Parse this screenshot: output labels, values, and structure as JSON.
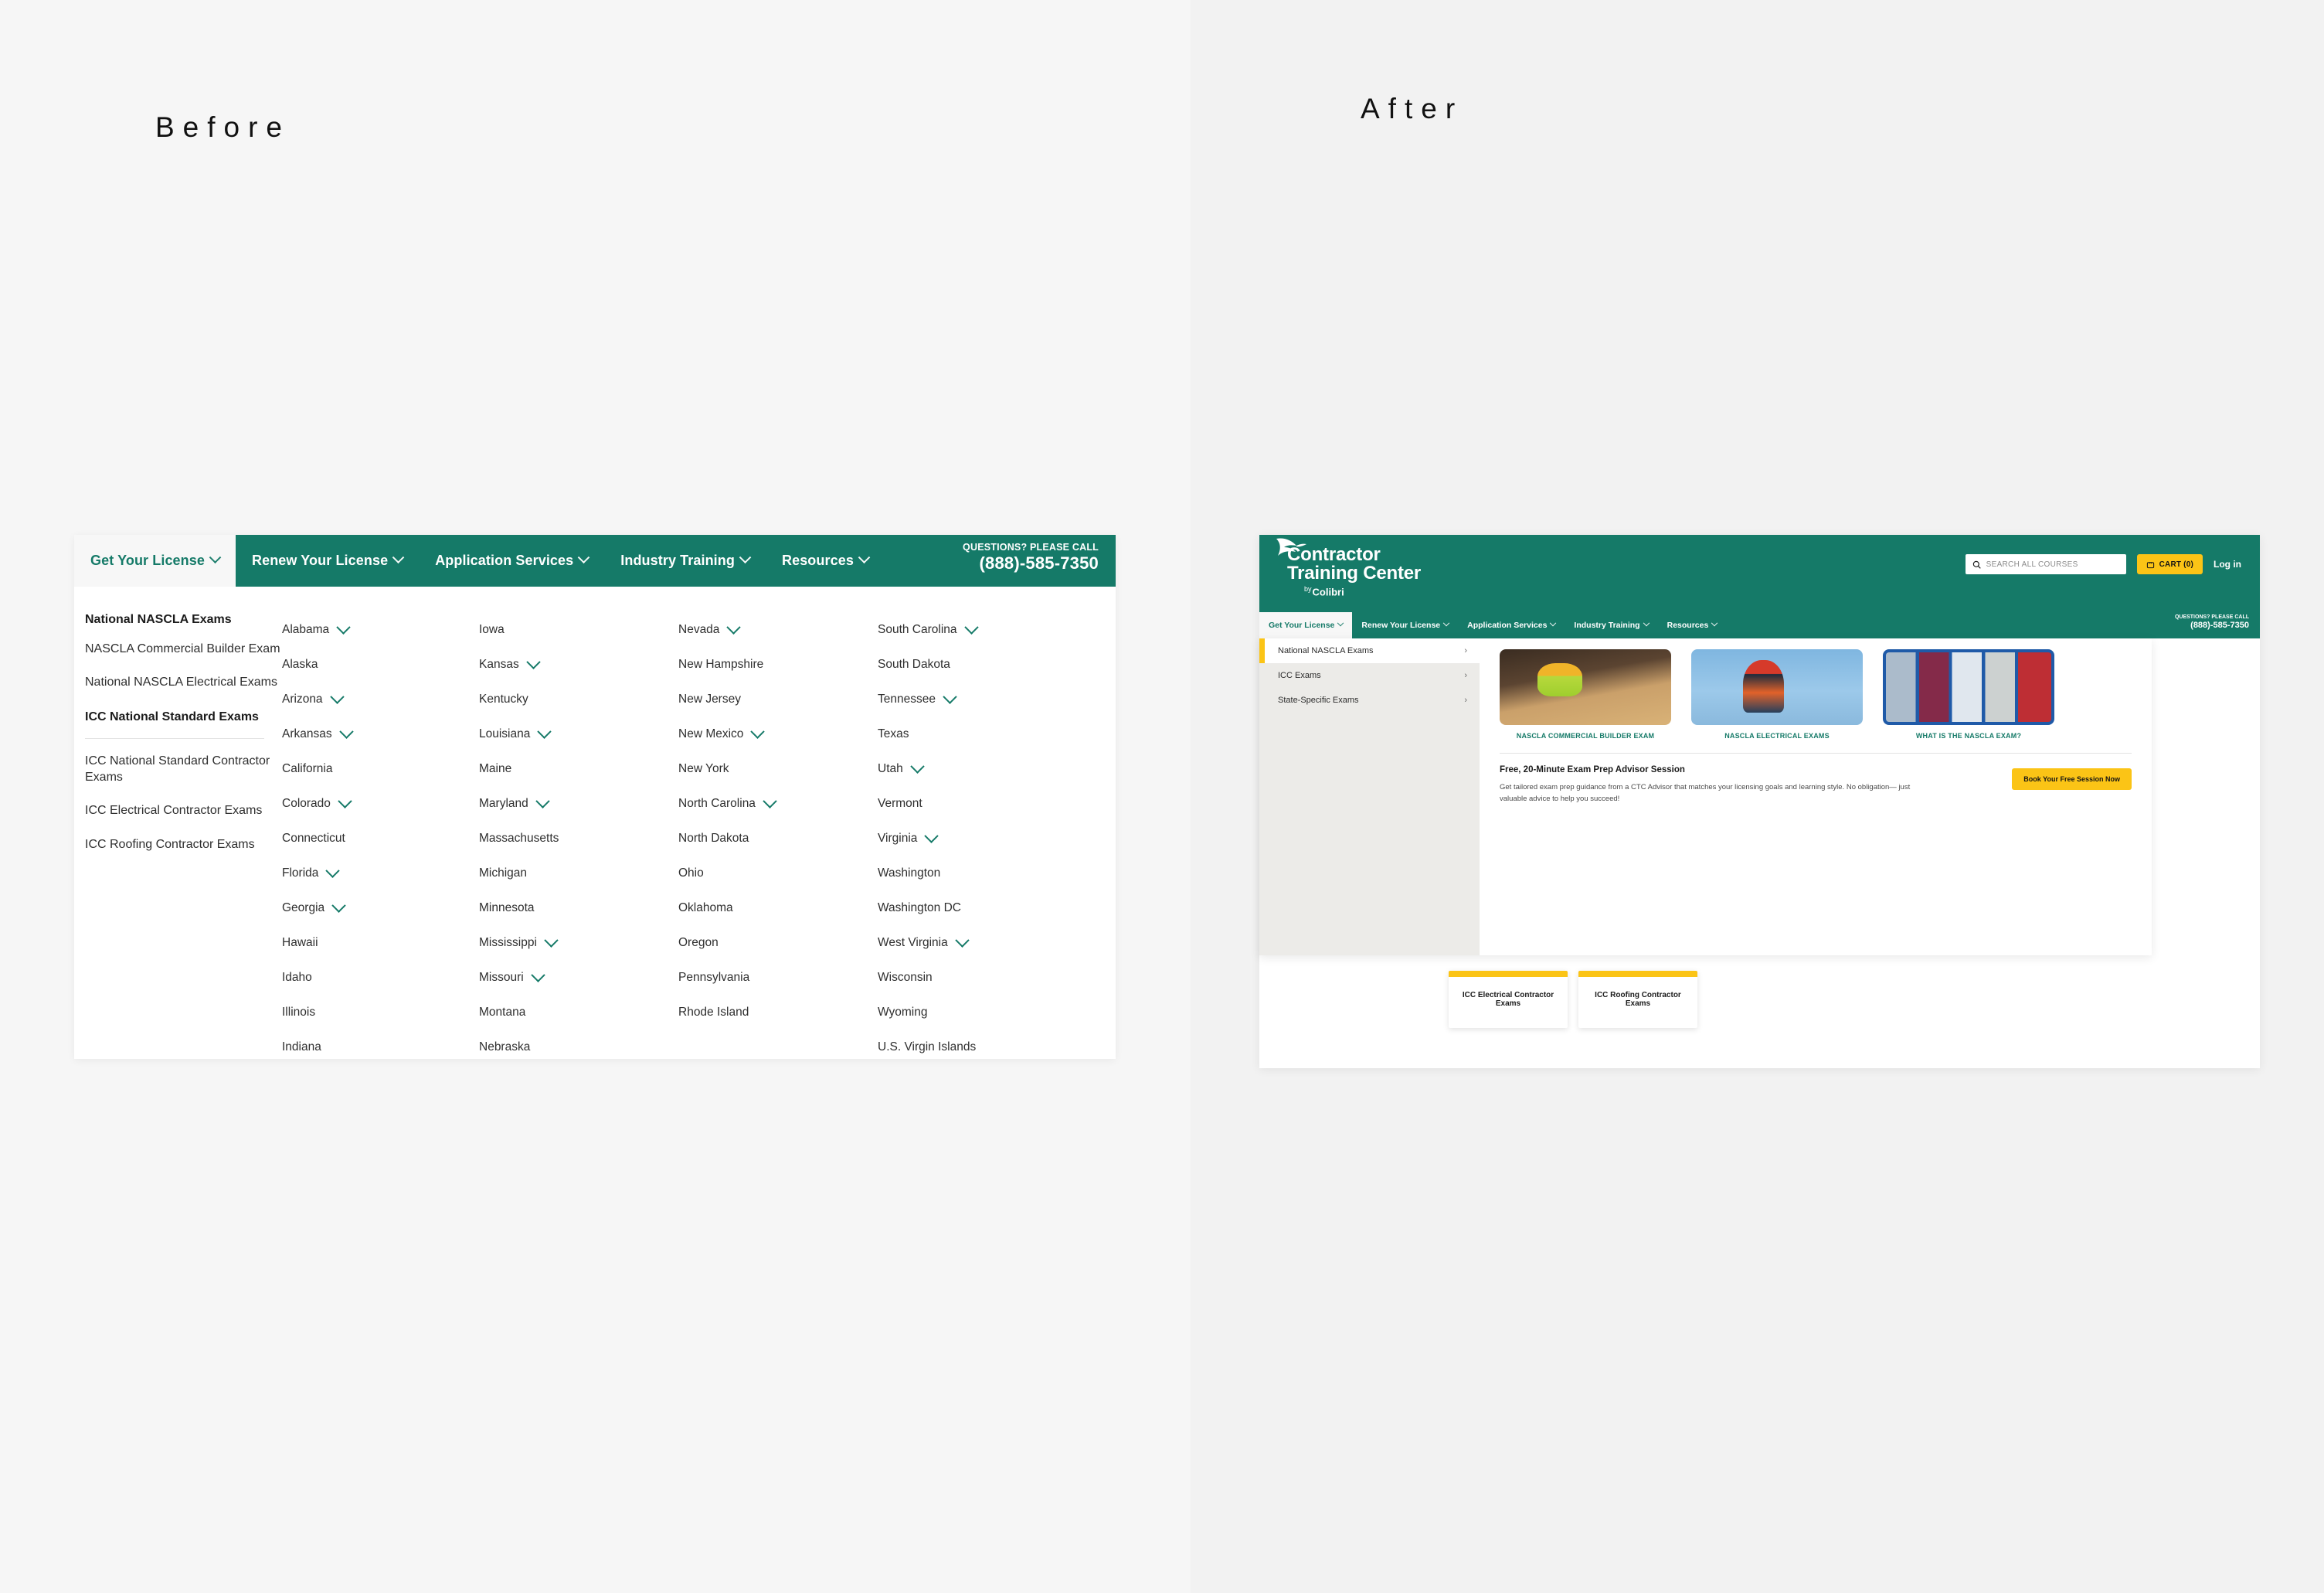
{
  "headings": {
    "before": "Before",
    "after": "After"
  },
  "brand": {
    "name_line1": "Contractor",
    "name_line2": "Training Center",
    "by_prefix": "by",
    "by_name": "Colibri",
    "green": "#157a68",
    "yellow": "#fbc416"
  },
  "before": {
    "nav": {
      "items": [
        {
          "label": "Get Your License",
          "active": true,
          "caret": "chevron-down-icon"
        },
        {
          "label": "Renew Your License",
          "active": false,
          "caret": "chevron-down-icon"
        },
        {
          "label": "Application Services",
          "active": false,
          "caret": "chevron-down-icon"
        },
        {
          "label": "Industry Training",
          "active": false,
          "caret": "chevron-down-icon"
        },
        {
          "label": "Resources",
          "active": false,
          "caret": "chevron-down-icon"
        }
      ],
      "questions_label": "QUESTIONS? PLEASE CALL",
      "phone": "(888)-585-7350"
    },
    "exam_groups": [
      {
        "type": "heading",
        "label": "National NASCLA Exams"
      },
      {
        "type": "link",
        "label": "NASCLA Commercial Builder Exam"
      },
      {
        "type": "link",
        "label": "National NASCLA Electrical Exams"
      },
      {
        "type": "heading",
        "label": "ICC National Standard Exams"
      },
      {
        "type": "link",
        "label": "ICC National Standard Contractor Exams"
      },
      {
        "type": "link",
        "label": "ICC Electrical Contractor Exams"
      },
      {
        "type": "link",
        "label": "ICC Roofing Contractor Exams"
      }
    ],
    "state_columns": [
      [
        {
          "name": "Alabama",
          "caret": true
        },
        {
          "name": "Alaska",
          "caret": false
        },
        {
          "name": "Arizona",
          "caret": true
        },
        {
          "name": "Arkansas",
          "caret": true
        },
        {
          "name": "California",
          "caret": false
        },
        {
          "name": "Colorado",
          "caret": true
        },
        {
          "name": "Connecticut",
          "caret": false
        },
        {
          "name": "Florida",
          "caret": true
        },
        {
          "name": "Georgia",
          "caret": true
        },
        {
          "name": "Hawaii",
          "caret": false
        },
        {
          "name": "Idaho",
          "caret": false
        },
        {
          "name": "Illinois",
          "caret": false
        },
        {
          "name": "Indiana",
          "caret": false
        }
      ],
      [
        {
          "name": "Iowa",
          "caret": false
        },
        {
          "name": "Kansas",
          "caret": true
        },
        {
          "name": "Kentucky",
          "caret": false
        },
        {
          "name": "Louisiana",
          "caret": true
        },
        {
          "name": "Maine",
          "caret": false
        },
        {
          "name": "Maryland",
          "caret": true
        },
        {
          "name": "Massachusetts",
          "caret": false
        },
        {
          "name": "Michigan",
          "caret": false
        },
        {
          "name": "Minnesota",
          "caret": false
        },
        {
          "name": "Mississippi",
          "caret": true
        },
        {
          "name": "Missouri",
          "caret": true
        },
        {
          "name": "Montana",
          "caret": false
        },
        {
          "name": "Nebraska",
          "caret": false
        }
      ],
      [
        {
          "name": "Nevada",
          "caret": true
        },
        {
          "name": "New Hampshire",
          "caret": false
        },
        {
          "name": "New Jersey",
          "caret": false
        },
        {
          "name": "New Mexico",
          "caret": true
        },
        {
          "name": "New York",
          "caret": false
        },
        {
          "name": "North Carolina",
          "caret": true
        },
        {
          "name": "North Dakota",
          "caret": false
        },
        {
          "name": "Ohio",
          "caret": false
        },
        {
          "name": "Oklahoma",
          "caret": false
        },
        {
          "name": "Oregon",
          "caret": false
        },
        {
          "name": "Pennsylvania",
          "caret": false
        },
        {
          "name": "Rhode Island",
          "caret": false
        }
      ],
      [
        {
          "name": "South Carolina",
          "caret": true
        },
        {
          "name": "South Dakota",
          "caret": false
        },
        {
          "name": "Tennessee",
          "caret": true
        },
        {
          "name": "Texas",
          "caret": false
        },
        {
          "name": "Utah",
          "caret": true
        },
        {
          "name": "Vermont",
          "caret": false
        },
        {
          "name": "Virginia",
          "caret": true
        },
        {
          "name": "Washington",
          "caret": false
        },
        {
          "name": "Washington DC",
          "caret": false
        },
        {
          "name": "West Virginia",
          "caret": true
        },
        {
          "name": "Wisconsin",
          "caret": false
        },
        {
          "name": "Wyoming",
          "caret": false
        },
        {
          "name": "U.S. Virgin Islands",
          "caret": false
        }
      ]
    ]
  },
  "after": {
    "search": {
      "placeholder": "SEARCH ALL COURSES",
      "icon": "search-icon"
    },
    "cart": {
      "label": "CART (0)",
      "icon": "cart-icon"
    },
    "login": {
      "label": "Log in"
    },
    "nav": {
      "items": [
        {
          "label": "Get Your License",
          "active": true
        },
        {
          "label": "Renew Your License",
          "active": false
        },
        {
          "label": "Application Services",
          "active": false
        },
        {
          "label": "Industry Training",
          "active": false
        },
        {
          "label": "Resources",
          "active": false
        }
      ],
      "questions_label": "QUESTIONS? PLEASE CALL",
      "phone": "(888)-585-7350"
    },
    "menu_items": [
      {
        "label": "National NASCLA Exams",
        "active": true,
        "arrow": "chevron-right-icon"
      },
      {
        "label": "ICC Exams",
        "active": false,
        "arrow": "chevron-right-icon"
      },
      {
        "label": "State-Specific Exams",
        "active": false,
        "arrow": "chevron-right-icon"
      }
    ],
    "cards": [
      {
        "label": "NASCLA COMMERCIAL BUILDER EXAM",
        "art": "t1"
      },
      {
        "label": "NASCLA ELECTRICAL EXAMS",
        "art": "t2"
      },
      {
        "label": "WHAT IS THE NASCLA EXAM?",
        "art": "t3"
      }
    ],
    "promo": {
      "title": "Free, 20-Minute Exam Prep Advisor Session",
      "body": "Get tailored exam prep guidance from a CTC Advisor that matches your licensing goals and learning style. No obligation— just valuable advice to help you succeed!",
      "button": "Book Your Free Session Now"
    },
    "bottom_cards": [
      {
        "label": "ICC Electrical Contractor Exams"
      },
      {
        "label": "ICC Roofing Contractor Exams"
      }
    ]
  }
}
